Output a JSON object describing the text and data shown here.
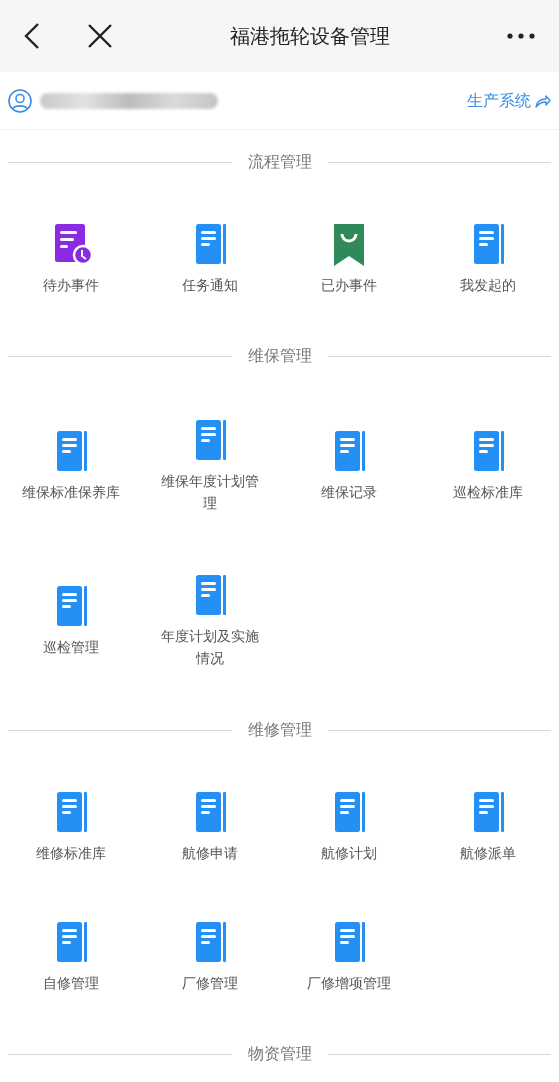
{
  "header": {
    "title": "福港拖轮设备管理"
  },
  "user_bar": {
    "system_link": "生产系统"
  },
  "sections": [
    {
      "title": "流程管理",
      "items": [
        {
          "label": "待办事件",
          "kind": "todo"
        },
        {
          "label": "任务通知",
          "kind": "doc"
        },
        {
          "label": "已办事件",
          "kind": "done"
        },
        {
          "label": "我发起的",
          "kind": "doc"
        }
      ]
    },
    {
      "title": "维保管理",
      "items": [
        {
          "label": "维保标准保养库",
          "kind": "doc"
        },
        {
          "label": "维保年度计划管理",
          "kind": "doc"
        },
        {
          "label": "维保记录",
          "kind": "doc"
        },
        {
          "label": "巡检标准库",
          "kind": "doc"
        },
        {
          "label": "巡检管理",
          "kind": "doc"
        },
        {
          "label": "年度计划及实施情况",
          "kind": "doc"
        }
      ]
    },
    {
      "title": "维修管理",
      "items": [
        {
          "label": "维修标准库",
          "kind": "doc"
        },
        {
          "label": "航修申请",
          "kind": "doc"
        },
        {
          "label": "航修计划",
          "kind": "doc"
        },
        {
          "label": "航修派单",
          "kind": "doc"
        },
        {
          "label": "自修管理",
          "kind": "doc"
        },
        {
          "label": "厂修管理",
          "kind": "doc"
        },
        {
          "label": "厂修增项管理",
          "kind": "doc"
        }
      ]
    },
    {
      "title": "物资管理"
    }
  ]
}
